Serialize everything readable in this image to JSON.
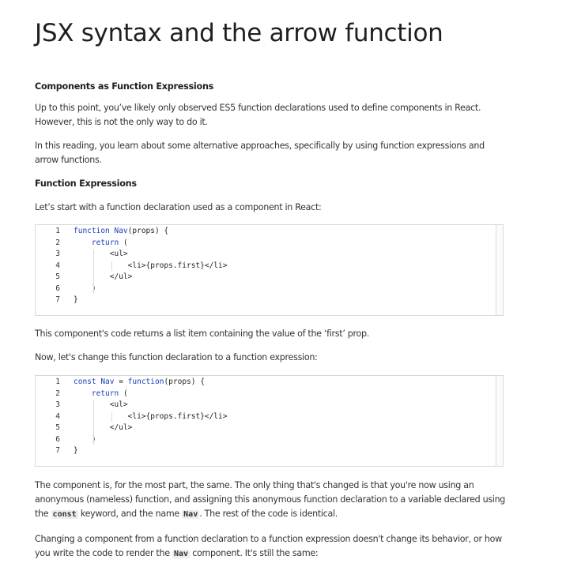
{
  "title": "JSX syntax and the arrow function",
  "section1_heading": "Components as Function Expressions",
  "para1": "Up to this point, you’ve likely only observed ES5 function declarations used to define components in React. However, this is not the only way to do it.",
  "para2": "In this reading, you learn about some alternative approaches, specifically by using function expressions and arrow functions.",
  "section2_heading": "Function Expressions",
  "para3": "Let’s start with a function declaration used as a component in React:",
  "code1": {
    "lines": [
      {
        "n": "1",
        "parts": [
          {
            "t": "function",
            "k": true
          },
          {
            "t": " Nav",
            "k": true
          },
          {
            "t": "(props) {",
            "k": false
          }
        ]
      },
      {
        "n": "2",
        "parts": [
          {
            "t": "    ",
            "k": false
          },
          {
            "t": "return",
            "k": true
          },
          {
            "t": " (",
            "k": false
          }
        ]
      },
      {
        "n": "3",
        "parts": [
          {
            "t": "        <ul>",
            "k": false
          }
        ]
      },
      {
        "n": "4",
        "parts": [
          {
            "t": "            <li>{props.first}</li>",
            "k": false
          }
        ]
      },
      {
        "n": "5",
        "parts": [
          {
            "t": "        </ul>",
            "k": false
          }
        ]
      },
      {
        "n": "6",
        "parts": [
          {
            "t": "    )",
            "k": false
          }
        ]
      },
      {
        "n": "7",
        "parts": [
          {
            "t": "}",
            "k": false
          }
        ]
      }
    ]
  },
  "para4": "This component's code returns a list item containing the value of the ‘first’ prop.",
  "para5": "Now, let's change this function declaration to a function expression:",
  "code2": {
    "lines": [
      {
        "n": "1",
        "parts": [
          {
            "t": "const",
            "k": true
          },
          {
            "t": " Nav",
            "k": true
          },
          {
            "t": " = ",
            "k": false
          },
          {
            "t": "function",
            "k": true
          },
          {
            "t": "(props) {",
            "k": false
          }
        ]
      },
      {
        "n": "2",
        "parts": [
          {
            "t": "    ",
            "k": false
          },
          {
            "t": "return",
            "k": true
          },
          {
            "t": " (",
            "k": false
          }
        ]
      },
      {
        "n": "3",
        "parts": [
          {
            "t": "        <ul>",
            "k": false
          }
        ]
      },
      {
        "n": "4",
        "parts": [
          {
            "t": "            <li>{props.first}</li>",
            "k": false
          }
        ]
      },
      {
        "n": "5",
        "parts": [
          {
            "t": "        </ul>",
            "k": false
          }
        ]
      },
      {
        "n": "6",
        "parts": [
          {
            "t": "    )",
            "k": false
          }
        ]
      },
      {
        "n": "7",
        "parts": [
          {
            "t": "}",
            "k": false
          }
        ]
      }
    ]
  },
  "para6": {
    "a": "The component is, for the most part, the same. The only thing that's changed is that you're now using an anonymous (nameless) function, and assigning this anonymous function declaration to a variable declared using the ",
    "code_const": "const",
    "b": " keyword, and the name ",
    "code_nav": "Nav",
    "c": ". The rest of the code is identical."
  },
  "para7": {
    "a": "Changing a component from a function declaration to a function expression doesn't change its behavior, or how you write the code to render the ",
    "code_nav": "Nav",
    "b": " component. It's still the same:"
  },
  "colors": {
    "keyword": "#1a3db8",
    "text": "#333333",
    "border": "#d9d9d9"
  }
}
